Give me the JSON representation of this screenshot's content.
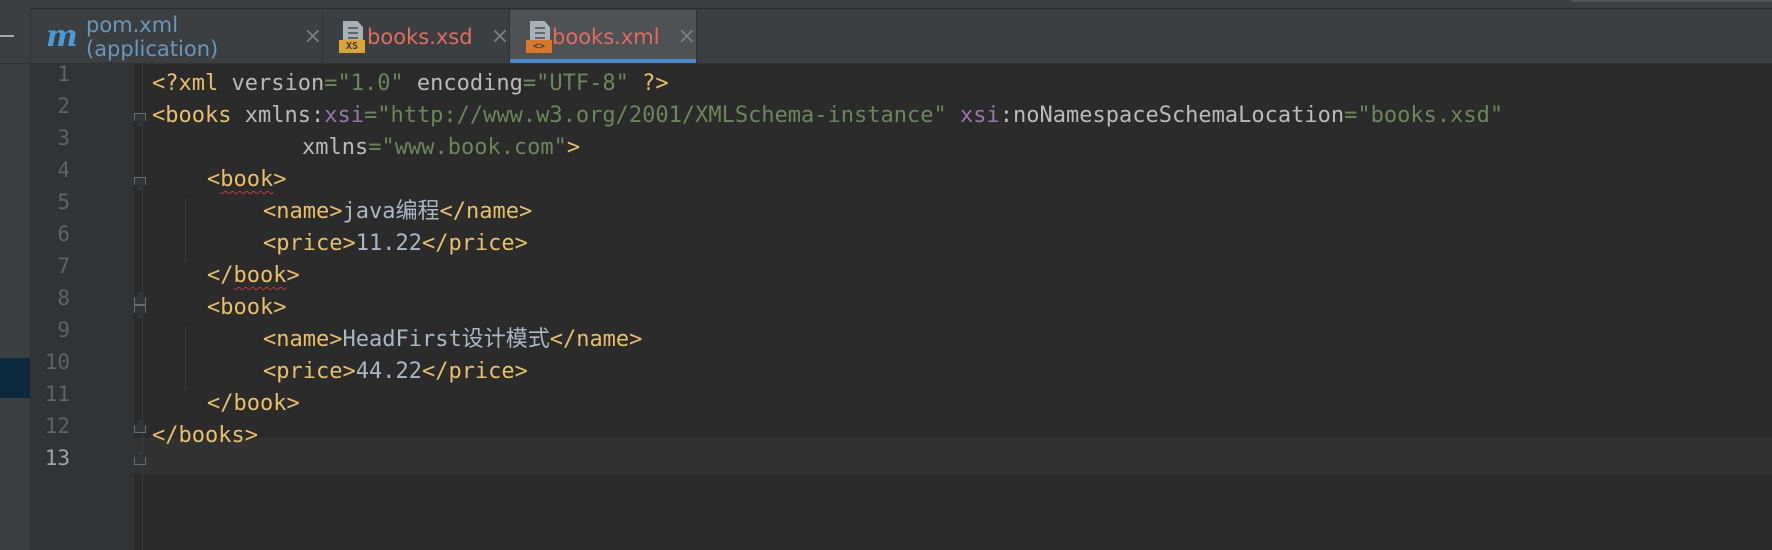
{
  "tabs": [
    {
      "label": "pom.xml (application)",
      "icon": "m",
      "color": "#6897bb",
      "active": false
    },
    {
      "label": "books.xsd",
      "icon": "XS",
      "color": "#e06c60",
      "active": false
    },
    {
      "label": "books.xml",
      "icon": "<>",
      "color": "#e06c60",
      "active": true
    }
  ],
  "close_glyph": "×",
  "line_numbers": [
    "1",
    "2",
    "3",
    "4",
    "5",
    "6",
    "7",
    "8",
    "9",
    "10",
    "11",
    "12",
    "13"
  ],
  "code": {
    "l1": {
      "a": "<?xml ",
      "b": "version",
      "c": "=",
      "d": "\"1.0\"",
      "e": " encoding",
      "f": "=",
      "g": "\"UTF-8\"",
      "h": " ?>"
    },
    "l2": {
      "a": "<books ",
      "b": "xmlns",
      "c": ":",
      "d": "xsi",
      "e": "=",
      "f": "\"http://www.w3.org/2001/XMLSchema-instance\"",
      "g": " ",
      "h": "xsi",
      "i": ":",
      "j": "noNamespaceSchemaLocation",
      "k": "=",
      "l": "\"books.xsd\""
    },
    "l3": {
      "a": "xmlns",
      "b": "=",
      "c": "\"www.book.com\"",
      "d": ">"
    },
    "l4": {
      "a": "<",
      "b": "book",
      "c": ">"
    },
    "l5": {
      "a": "<name>",
      "b": "java编程",
      "c": "</name>"
    },
    "l6": {
      "a": "<price>",
      "b": "11.22",
      "c": "</price>"
    },
    "l7": {
      "a": "</",
      "b": "book",
      "c": ">"
    },
    "l8": {
      "a": "<book>"
    },
    "l9": {
      "a": "<name>",
      "b": "HeadFirst设计模式",
      "c": "</name>"
    },
    "l10": {
      "a": "<price>",
      "b": "44.22",
      "c": "</price>"
    },
    "l11": {
      "a": "</book>"
    },
    "l12": {
      "a": "</books>"
    }
  }
}
